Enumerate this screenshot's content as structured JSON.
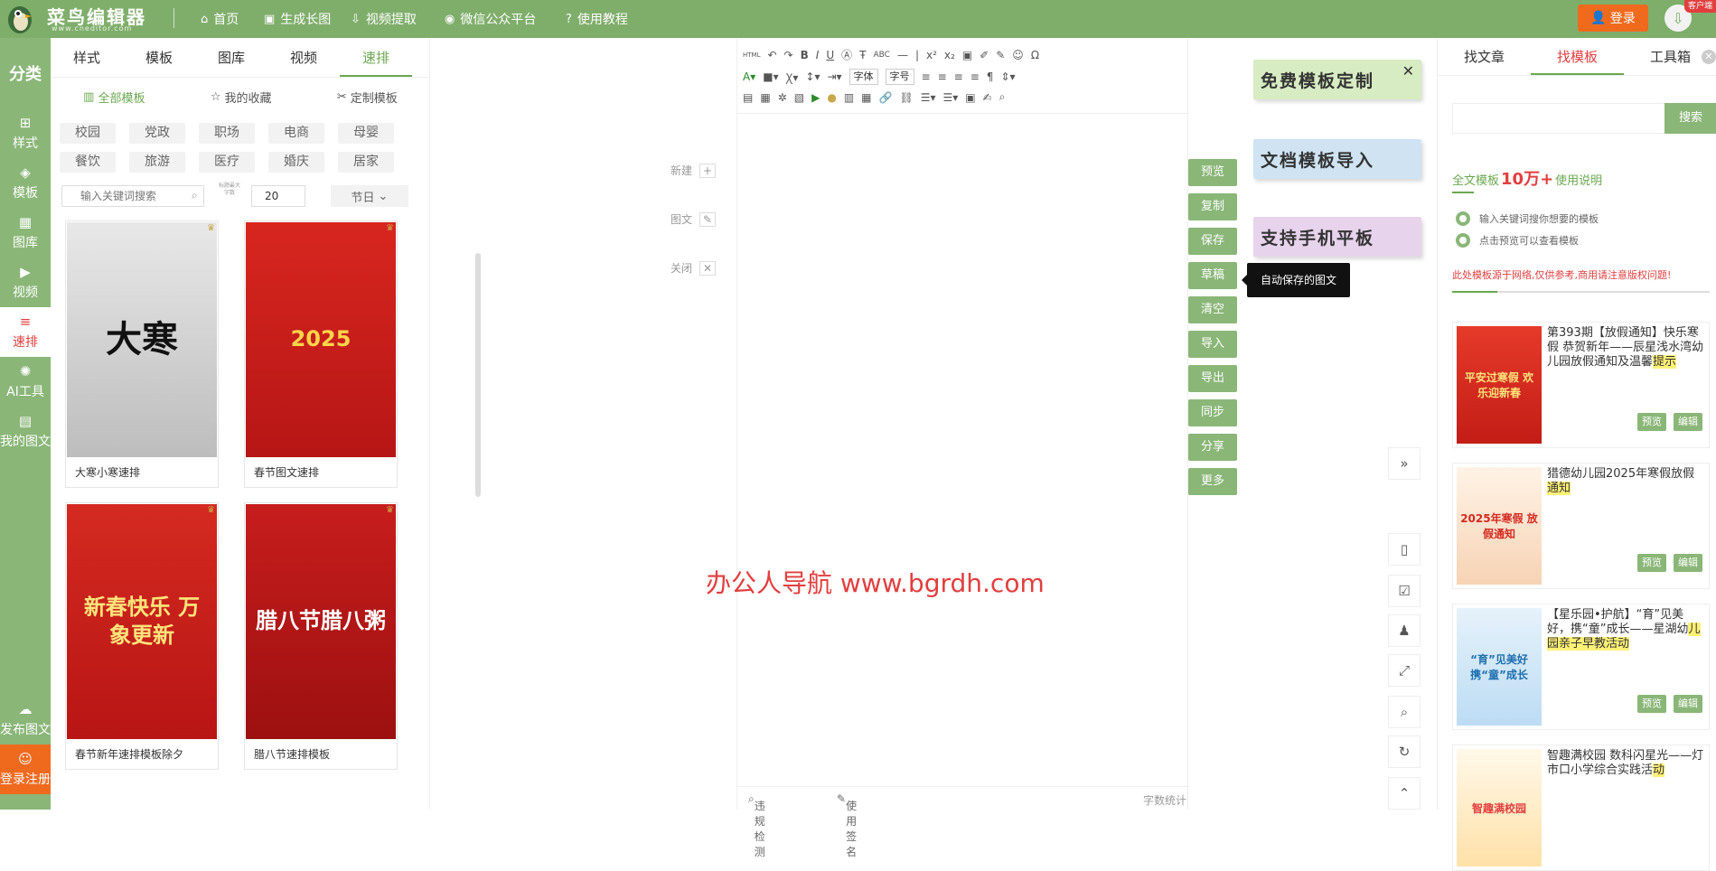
{
  "app": {
    "logo_title": "菜鸟编辑器",
    "logo_sub": "www.cneditor.com",
    "corner_badge": "客户端"
  },
  "topnav": [
    {
      "icon": "home-icon",
      "glyph": "⌂",
      "label": "首页"
    },
    {
      "icon": "image-icon",
      "glyph": "▣",
      "label": "生成长图"
    },
    {
      "icon": "download-icon",
      "glyph": "⇩",
      "label": "视频提取"
    },
    {
      "icon": "wechat-icon",
      "glyph": "◉",
      "label": "微信公众平台"
    },
    {
      "icon": "help-icon",
      "glyph": "?",
      "label": "使用教程"
    }
  ],
  "login_label": "登录",
  "leftnav": {
    "category": "分类",
    "items": [
      {
        "icon": "style-icon",
        "glyph": "⊞",
        "label": "样式"
      },
      {
        "icon": "template-icon",
        "glyph": "◈",
        "label": "模板"
      },
      {
        "icon": "gallery-icon",
        "glyph": "▦",
        "label": "图库"
      },
      {
        "icon": "video-icon",
        "glyph": "▶",
        "label": "视频"
      },
      {
        "icon": "quick-layout-icon",
        "glyph": "≡",
        "label": "速排"
      },
      {
        "icon": "ai-icon",
        "glyph": "✺",
        "label": "AI工具"
      },
      {
        "icon": "my-article-icon",
        "glyph": "▤",
        "label": "我的图文"
      },
      {
        "icon": "publish-icon",
        "glyph": "☁",
        "label": "发布图文"
      },
      {
        "icon": "user-icon",
        "glyph": "☺",
        "label": "登录注册"
      }
    ]
  },
  "panel": {
    "tabs": [
      "样式",
      "模板",
      "图库",
      "视频",
      "速排"
    ],
    "subtabs": [
      {
        "icon": "all-icon",
        "glyph": "▥",
        "label": "全部模板"
      },
      {
        "icon": "star-icon",
        "glyph": "☆",
        "label": "我的收藏"
      },
      {
        "icon": "custom-icon",
        "glyph": "✂",
        "label": "定制模板"
      }
    ],
    "tags": [
      "校园",
      "党政",
      "职场",
      "电商",
      "母婴",
      "餐饮",
      "旅游",
      "医疗",
      "婚庆",
      "居家"
    ],
    "search_placeholder": "输入关键词搜索",
    "limit_label": "标题最大字数",
    "limit_value": "20",
    "festival_label": "节日",
    "cards": [
      {
        "label": "大寒小寒速排",
        "title_art": "大寒"
      },
      {
        "label": "春节图文速排",
        "title_art": "2025"
      },
      {
        "label": "春节新年速排模板除夕",
        "title_art": "新春快乐 万象更新"
      },
      {
        "label": "腊八节速排模板",
        "title_art": "腊八节腊八粥"
      }
    ]
  },
  "editor": {
    "font_select": "字体",
    "size_select": "字号",
    "watermark": "办公人导航  www.bgrdh.com",
    "footer_check": "违规检测",
    "footer_sign": "使用签名",
    "footer_count": "字数统计"
  },
  "sidebtns": [
    {
      "label": "新建",
      "glyph": "+"
    },
    {
      "label": "图文",
      "glyph": "✎"
    },
    {
      "label": "关闭",
      "glyph": "✕"
    }
  ],
  "actions": [
    "预览",
    "复制",
    "保存",
    "草稿",
    "清空",
    "导入",
    "导出",
    "同步",
    "分享",
    "更多"
  ],
  "tooltip": "自动保存的图文",
  "banners": [
    {
      "text": "免费模板定制",
      "color": "#d7ecc3"
    },
    {
      "text": "文档模板导入",
      "color": "#cfe3f3"
    },
    {
      "text": "支持手机平板",
      "color": "#e7d3ec"
    }
  ],
  "tools": [
    {
      "icon": "expand-icon",
      "glyph": "»"
    },
    {
      "icon": "book-icon",
      "glyph": "▯"
    },
    {
      "icon": "calendar-icon",
      "glyph": "☑"
    },
    {
      "icon": "qq-icon",
      "glyph": "♟"
    },
    {
      "icon": "fullscreen-icon",
      "glyph": "⤢"
    },
    {
      "icon": "search-icon",
      "glyph": "⌕"
    },
    {
      "icon": "refresh-icon",
      "glyph": "↻"
    },
    {
      "icon": "top-icon",
      "glyph": "⌃"
    }
  ],
  "right": {
    "tabs": [
      "找文章",
      "找模板",
      "工具箱"
    ],
    "search_btn": "搜索",
    "count_prefix": "全文模板",
    "count_num": "10万+",
    "count_suffix": "使用说明",
    "bullets": [
      "输入关键词搜你想要的模板",
      "点击预览可以查看模板"
    ],
    "warning": "此处模板源于网络,仅供参考,商用请注意版权问题!",
    "preview_btn": "预览",
    "edit_btn": "编辑",
    "items": [
      {
        "pre": "第393期【放假通知】快乐寒假 恭贺新年——辰星浅水湾幼儿园放假通知及温馨",
        "hl": "提示",
        "thumb": "平安过寒假 欢乐迎新春"
      },
      {
        "pre": "猎德幼儿园2025年寒假放假",
        "hl": "通知",
        "thumb": "2025年寒假 放假通知"
      },
      {
        "pre": "【星乐园•护航】“育”见美好，携“童”成长——星湖幼",
        "hl": "儿园亲子早教活动",
        "thumb": "“育”见美好 携“童”成长"
      },
      {
        "pre": "智趣满校园 数科闪星光——灯市口小学综合实践活",
        "hl": "动",
        "thumb": "智趣满校园"
      }
    ]
  }
}
